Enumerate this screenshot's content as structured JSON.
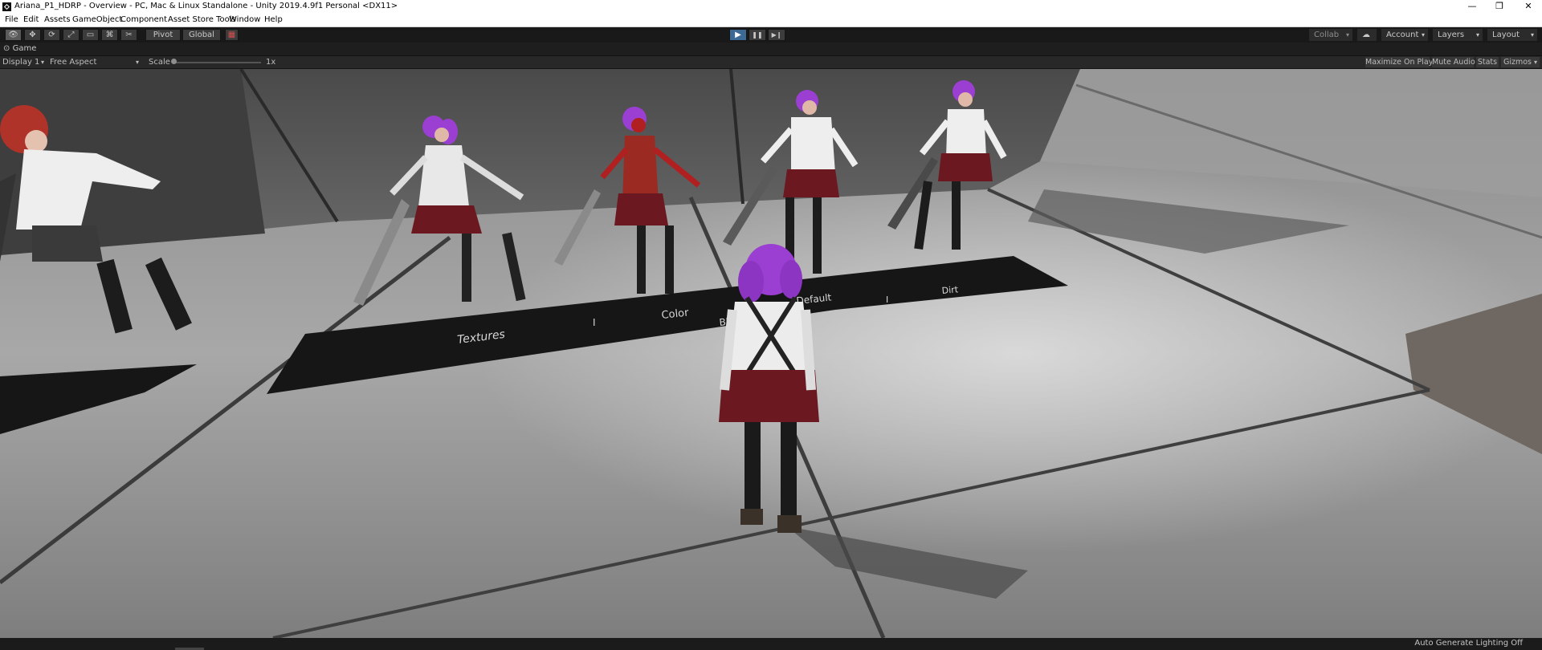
{
  "window": {
    "title": "Ariana_P1_HDRP - Overview - PC, Mac & Linux Standalone - Unity 2019.4.9f1 Personal <DX11>",
    "minimize": "—",
    "maximize": "❐",
    "close": "✕"
  },
  "menu": [
    "File",
    "Edit",
    "Assets",
    "GameObject",
    "Component",
    "Asset Store Tools",
    "Window",
    "Help"
  ],
  "toolbar": {
    "tools": [
      {
        "name": "hand-tool",
        "glyph": "👁"
      },
      {
        "name": "move-tool",
        "glyph": "✥"
      },
      {
        "name": "rotate-tool",
        "glyph": "⟳"
      },
      {
        "name": "scale-tool",
        "glyph": "⤢"
      },
      {
        "name": "rect-tool",
        "glyph": "▭"
      },
      {
        "name": "transform-tool",
        "glyph": "⌘"
      },
      {
        "name": "custom-tool",
        "glyph": "✂"
      }
    ],
    "pivot": "Pivot",
    "global": "Global",
    "play_glyph": "▶",
    "pause_glyph": "❚❚",
    "step_glyph": "▶❙",
    "collab": "Collab",
    "account": "Account",
    "layers": "Layers",
    "layout": "Layout",
    "accent_color": "#3d6a94"
  },
  "game_tab": {
    "label": "Game"
  },
  "game_toolbar": {
    "display": "Display 1",
    "aspect": "Free Aspect",
    "scale_label": "Scale",
    "scale_value": "1x",
    "scale_level": 0.0,
    "maximize_on_play": "Maximize On Play",
    "mute_audio": "Mute Audio",
    "stats": "Stats",
    "gizmos": "Gizmos"
  },
  "scene": {
    "signs": [
      "Textures",
      "I",
      "Color",
      "BLEND MODE",
      "Default",
      "I",
      "Dirt"
    ],
    "hair_color": "#9a3fd1",
    "floor_color": "#9a9a9a"
  },
  "status": {
    "lighting": "Auto Generate Lighting Off"
  }
}
